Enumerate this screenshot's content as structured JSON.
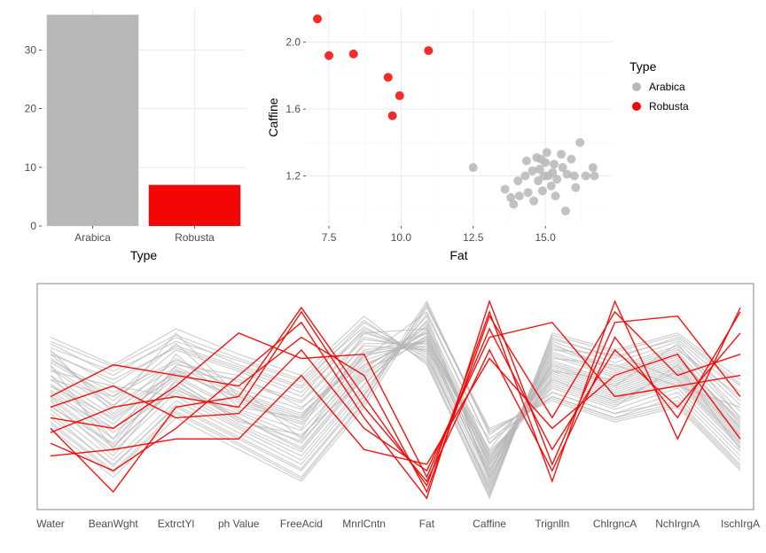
{
  "legend_title": "Type",
  "colors": {
    "Arabica": "#b7b7b7",
    "Robusta": "#f30603"
  },
  "chart_data": [
    {
      "id": "bar",
      "type": "bar",
      "xlabel": "Type",
      "ylabel": "",
      "categories": [
        "Arabica",
        "Robusta"
      ],
      "values": [
        36,
        7
      ],
      "series_colors": [
        "Arabica",
        "Robusta"
      ],
      "ylim": [
        0,
        37
      ],
      "y_ticks": [
        0,
        10,
        20,
        30
      ]
    },
    {
      "id": "scatter",
      "type": "scatter",
      "xlabel": "Fat",
      "ylabel": "Caffine",
      "xlim": [
        6.7,
        17.3
      ],
      "ylim": [
        0.9,
        2.2
      ],
      "x_ticks": [
        7.5,
        10.0,
        12.5,
        15.0
      ],
      "y_ticks": [
        1.2,
        1.6,
        2.0
      ],
      "series": [
        {
          "name": "Robusta",
          "points": [
            [
              7.1,
              2.14
            ],
            [
              7.5,
              1.92
            ],
            [
              8.35,
              1.93
            ],
            [
              9.55,
              1.79
            ],
            [
              9.7,
              1.56
            ],
            [
              9.95,
              1.68
            ],
            [
              10.95,
              1.95
            ]
          ]
        },
        {
          "name": "Arabica",
          "points": [
            [
              12.5,
              1.25
            ],
            [
              13.6,
              1.12
            ],
            [
              13.8,
              1.07
            ],
            [
              13.9,
              1.03
            ],
            [
              14.05,
              1.17
            ],
            [
              14.1,
              1.08
            ],
            [
              14.3,
              1.2
            ],
            [
              14.35,
              1.29
            ],
            [
              14.4,
              1.1
            ],
            [
              14.55,
              1.23
            ],
            [
              14.6,
              1.05
            ],
            [
              14.7,
              1.31
            ],
            [
              14.75,
              1.17
            ],
            [
              14.8,
              1.24
            ],
            [
              14.85,
              1.3
            ],
            [
              14.9,
              1.11
            ],
            [
              14.95,
              1.2
            ],
            [
              15.0,
              1.28
            ],
            [
              15.05,
              1.34
            ],
            [
              15.1,
              1.2
            ],
            [
              15.2,
              1.14
            ],
            [
              15.25,
              1.22
            ],
            [
              15.3,
              1.27
            ],
            [
              15.35,
              1.08
            ],
            [
              15.4,
              1.18
            ],
            [
              15.55,
              1.33
            ],
            [
              15.6,
              1.25
            ],
            [
              15.7,
              0.99
            ],
            [
              15.75,
              1.21
            ],
            [
              15.9,
              1.3
            ],
            [
              16.0,
              1.2
            ],
            [
              16.05,
              1.13
            ],
            [
              16.2,
              1.4
            ],
            [
              16.4,
              1.2
            ],
            [
              16.65,
              1.25
            ],
            [
              16.7,
              1.2
            ]
          ]
        }
      ]
    },
    {
      "id": "parallel",
      "type": "line",
      "xlabel": "",
      "ylabel": "",
      "ylim": [
        0,
        1
      ],
      "axes": [
        "Water",
        "BeanWght",
        "ExtrctYl",
        "ph Value",
        "FreeAcid",
        "MnrlCntn",
        "Fat",
        "Caffine",
        "Trignlln",
        "ChlrgncA",
        "NchIrgnA",
        "IschIrgA"
      ],
      "series": [
        {
          "name": "Arabica",
          "lines": [
            [
              0.7,
              0.45,
              0.8,
              0.5,
              0.35,
              0.8,
              0.82,
              0.2,
              0.65,
              0.55,
              0.75,
              0.4
            ],
            [
              0.6,
              0.3,
              0.7,
              0.45,
              0.4,
              0.75,
              0.75,
              0.15,
              0.7,
              0.6,
              0.7,
              0.35
            ],
            [
              0.55,
              0.4,
              0.6,
              0.55,
              0.3,
              0.7,
              0.8,
              0.18,
              0.6,
              0.5,
              0.6,
              0.3
            ],
            [
              0.65,
              0.25,
              0.65,
              0.6,
              0.45,
              0.65,
              0.78,
              0.22,
              0.55,
              0.45,
              0.65,
              0.25
            ],
            [
              0.5,
              0.35,
              0.55,
              0.4,
              0.25,
              0.6,
              0.85,
              0.12,
              0.68,
              0.65,
              0.55,
              0.45
            ],
            [
              0.58,
              0.5,
              0.75,
              0.48,
              0.38,
              0.72,
              0.76,
              0.25,
              0.62,
              0.58,
              0.68,
              0.38
            ],
            [
              0.72,
              0.42,
              0.68,
              0.52,
              0.42,
              0.68,
              0.9,
              0.28,
              0.58,
              0.48,
              0.62,
              0.32
            ],
            [
              0.62,
              0.55,
              0.5,
              0.35,
              0.2,
              0.55,
              0.88,
              0.1,
              0.72,
              0.7,
              0.58,
              0.28
            ],
            [
              0.45,
              0.28,
              0.62,
              0.58,
              0.48,
              0.78,
              0.72,
              0.3,
              0.5,
              0.4,
              0.5,
              0.2
            ],
            [
              0.68,
              0.48,
              0.72,
              0.62,
              0.5,
              0.82,
              0.7,
              0.05,
              0.75,
              0.62,
              0.72,
              0.5
            ],
            [
              0.4,
              0.18,
              0.45,
              0.3,
              0.15,
              0.5,
              0.95,
              0.32,
              0.52,
              0.42,
              0.48,
              0.18
            ],
            [
              0.75,
              0.6,
              0.78,
              0.65,
              0.55,
              0.85,
              0.68,
              0.08,
              0.78,
              0.68,
              0.78,
              0.55
            ],
            [
              0.53,
              0.33,
              0.53,
              0.42,
              0.28,
              0.63,
              0.83,
              0.17,
              0.63,
              0.53,
              0.63,
              0.33
            ],
            [
              0.48,
              0.22,
              0.58,
              0.38,
              0.32,
              0.58,
              0.79,
              0.21,
              0.57,
              0.47,
              0.57,
              0.27
            ],
            [
              0.67,
              0.52,
              0.67,
              0.57,
              0.47,
              0.77,
              0.73,
              0.13,
              0.73,
              0.63,
              0.73,
              0.43
            ],
            [
              0.35,
              0.12,
              0.4,
              0.25,
              0.1,
              0.45,
              0.92,
              0.35,
              0.48,
              0.38,
              0.45,
              0.15
            ],
            [
              0.78,
              0.65,
              0.82,
              0.7,
              0.6,
              0.88,
              0.65,
              0.03,
              0.8,
              0.72,
              0.8,
              0.58
            ],
            [
              0.56,
              0.37,
              0.63,
              0.47,
              0.37,
              0.67,
              0.77,
              0.19,
              0.61,
              0.51,
              0.61,
              0.31
            ],
            [
              0.44,
              0.2,
              0.48,
              0.33,
              0.18,
              0.53,
              0.86,
              0.24,
              0.54,
              0.44,
              0.54,
              0.24
            ],
            [
              0.7,
              0.58,
              0.73,
              0.63,
              0.52,
              0.8,
              0.71,
              0.06,
              0.76,
              0.66,
              0.76,
              0.48
            ],
            [
              0.52,
              0.3,
              0.57,
              0.4,
              0.26,
              0.61,
              0.81,
              0.16,
              0.59,
              0.49,
              0.59,
              0.29
            ],
            [
              0.46,
              0.24,
              0.52,
              0.36,
              0.22,
              0.56,
              0.84,
              0.23,
              0.56,
              0.46,
              0.56,
              0.26
            ],
            [
              0.63,
              0.44,
              0.61,
              0.5,
              0.4,
              0.7,
              0.74,
              0.11,
              0.69,
              0.59,
              0.69,
              0.37
            ],
            [
              0.38,
              0.15,
              0.43,
              0.28,
              0.12,
              0.48,
              0.93,
              0.33,
              0.5,
              0.4,
              0.47,
              0.17
            ],
            [
              0.73,
              0.62,
              0.76,
              0.67,
              0.57,
              0.83,
              0.67,
              0.04,
              0.77,
              0.69,
              0.77,
              0.52
            ],
            [
              0.58,
              0.39,
              0.6,
              0.44,
              0.34,
              0.65,
              0.78,
              0.18,
              0.64,
              0.54,
              0.64,
              0.34
            ],
            [
              0.5,
              0.27,
              0.54,
              0.37,
              0.24,
              0.59,
              0.82,
              0.22,
              0.58,
              0.48,
              0.58,
              0.28
            ],
            [
              0.66,
              0.5,
              0.66,
              0.54,
              0.44,
              0.74,
              0.72,
              0.09,
              0.71,
              0.61,
              0.71,
              0.4
            ],
            [
              0.42,
              0.17,
              0.46,
              0.31,
              0.16,
              0.51,
              0.89,
              0.28,
              0.52,
              0.42,
              0.52,
              0.22
            ],
            [
              0.76,
              0.64,
              0.79,
              0.68,
              0.58,
              0.86,
              0.66,
              0.02,
              0.79,
              0.71,
              0.79,
              0.56
            ],
            [
              0.55,
              0.35,
              0.59,
              0.43,
              0.31,
              0.64,
              0.8,
              0.2,
              0.62,
              0.52,
              0.62,
              0.32
            ],
            [
              0.49,
              0.26,
              0.55,
              0.39,
              0.29,
              0.62,
              0.77,
              0.14,
              0.66,
              0.56,
              0.66,
              0.36
            ],
            [
              0.64,
              0.46,
              0.64,
              0.51,
              0.41,
              0.71,
              0.75,
              0.12,
              0.67,
              0.57,
              0.67,
              0.39
            ],
            [
              0.37,
              0.14,
              0.42,
              0.27,
              0.11,
              0.47,
              0.94,
              0.34,
              0.49,
              0.39,
              0.46,
              0.16
            ],
            [
              0.71,
              0.56,
              0.74,
              0.64,
              0.54,
              0.81,
              0.69,
              0.07,
              0.74,
              0.64,
              0.74,
              0.46
            ],
            [
              0.6,
              0.41,
              0.62,
              0.49,
              0.39,
              0.69,
              0.76,
              0.15,
              0.65,
              0.55,
              0.65,
              0.35
            ]
          ]
        },
        {
          "name": "Robusta",
          "lines": [
            [
              0.35,
              0.05,
              0.45,
              0.5,
              0.92,
              0.5,
              0.08,
              0.9,
              0.1,
              0.95,
              0.3,
              0.92
            ],
            [
              0.45,
              0.55,
              0.4,
              0.42,
              0.72,
              0.35,
              0.15,
              0.78,
              0.85,
              0.5,
              0.55,
              0.6
            ],
            [
              0.28,
              0.15,
              0.35,
              0.6,
              0.85,
              0.4,
              0.02,
              0.95,
              0.18,
              0.85,
              0.88,
              0.5
            ],
            [
              0.4,
              0.35,
              0.55,
              0.8,
              0.68,
              0.7,
              0.12,
              0.82,
              0.25,
              0.72,
              0.45,
              0.8
            ],
            [
              0.22,
              0.25,
              0.3,
              0.3,
              0.6,
              0.25,
              0.18,
              0.68,
              0.35,
              0.6,
              0.7,
              0.3
            ],
            [
              0.5,
              0.65,
              0.6,
              0.55,
              0.78,
              0.6,
              0.05,
              0.88,
              0.4,
              0.9,
              0.6,
              0.7
            ],
            [
              0.33,
              0.45,
              0.5,
              0.45,
              0.9,
              0.45,
              0.1,
              0.72,
              0.15,
              0.78,
              0.4,
              0.9
            ]
          ]
        }
      ]
    }
  ]
}
